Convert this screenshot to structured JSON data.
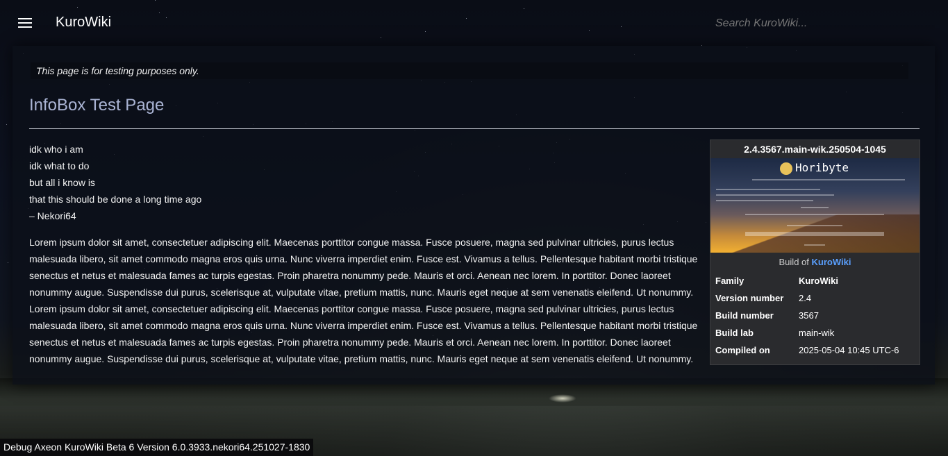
{
  "header": {
    "site_title": "KuroWiki",
    "search_placeholder": "Search KuroWiki..."
  },
  "notice": "This page is for testing purposes only.",
  "page": {
    "title": "InfoBox Test Page",
    "poem": [
      "idk who i am",
      "idk what to do",
      "but all i know is",
      "that this should be done a long time ago",
      "– Nekori64"
    ],
    "body": "Lorem ipsum dolor sit amet, consectetuer adipiscing elit. Maecenas porttitor congue massa. Fusce posuere, magna sed pulvinar ultricies, purus lectus malesuada libero, sit amet commodo magna eros quis urna. Nunc viverra imperdiet enim. Fusce est. Vivamus a tellus. Pellentesque habitant morbi tristique senectus et netus et malesuada fames ac turpis egestas. Proin pharetra nonummy pede. Mauris et orci. Aenean nec lorem. In porttitor. Donec laoreet nonummy augue. Suspendisse dui purus, scelerisque at, vulputate vitae, pretium mattis, nunc. Mauris eget neque at sem venenatis eleifend. Ut nonummy. Lorem ipsum dolor sit amet, consectetuer adipiscing elit. Maecenas porttitor congue massa. Fusce posuere, magna sed pulvinar ultricies, purus lectus malesuada libero, sit amet commodo magna eros quis urna. Nunc viverra imperdiet enim. Fusce est. Vivamus a tellus. Pellentesque habitant morbi tristique senectus et netus et malesuada fames ac turpis egestas. Proin pharetra nonummy pede. Mauris et orci. Aenean nec lorem. In porttitor. Donec laoreet nonummy augue. Suspendisse dui purus, scelerisque at, vulputate vitae, pretium mattis, nunc. Mauris eget neque at sem venenatis eleifend. Ut nonummy."
  },
  "infobox": {
    "title": "2.4.3567.main-wik.250504-1045",
    "image_logo_text": "Horibyte",
    "caption_prefix": "Build of",
    "caption_link": "KuroWiki",
    "rows": [
      {
        "key": "Family",
        "value": "KuroWiki",
        "link": true
      },
      {
        "key": "Version number",
        "value": "2.4",
        "link": false
      },
      {
        "key": "Build number",
        "value": "3567",
        "link": false
      },
      {
        "key": "Build lab",
        "value": "main-wik",
        "link": false
      },
      {
        "key": "Compiled on",
        "value": "2025-05-04 10:45 UTC-6",
        "link": false
      }
    ]
  },
  "debug_bar": "Debug Axeon KuroWiki Beta 6 Version 6.0.3933.nekori64.251027-1830",
  "colors": {
    "accent_link": "#5aa0ff",
    "title": "#aab4d4",
    "infobox_bg": "#2a2b2e"
  }
}
